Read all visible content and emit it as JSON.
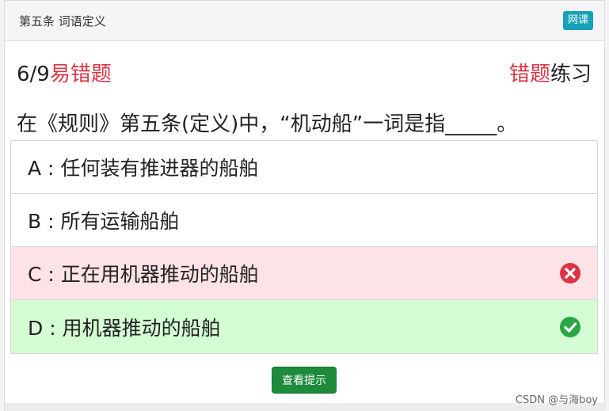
{
  "header": {
    "section_title": "第五条 词语定义",
    "badge": "网课"
  },
  "progress": {
    "count": "6/9",
    "label": "易错题"
  },
  "mode": {
    "highlight": "错题",
    "rest": "练习"
  },
  "question": {
    "text": "在《规则》第五条(定义)中，“机动船”一词是指_____。"
  },
  "options": [
    {
      "letter": "A",
      "text": "任何装有推进器的船舶",
      "state": "normal"
    },
    {
      "letter": "B",
      "text": "所有运输船舶",
      "state": "normal"
    },
    {
      "letter": "C",
      "text": "正在用机器推动的船舶",
      "state": "wrong",
      "icon": "x-circle-icon"
    },
    {
      "letter": "D",
      "text": "用机器推动的船舶",
      "state": "correct",
      "icon": "check-circle-icon"
    }
  ],
  "hint_button": "查看提示",
  "credit": "CSDN @与海boy",
  "colors": {
    "accent_red": "#dc3545",
    "accent_green": "#28a745",
    "badge": "#17a2b8",
    "button_green": "#1e8a3b"
  }
}
